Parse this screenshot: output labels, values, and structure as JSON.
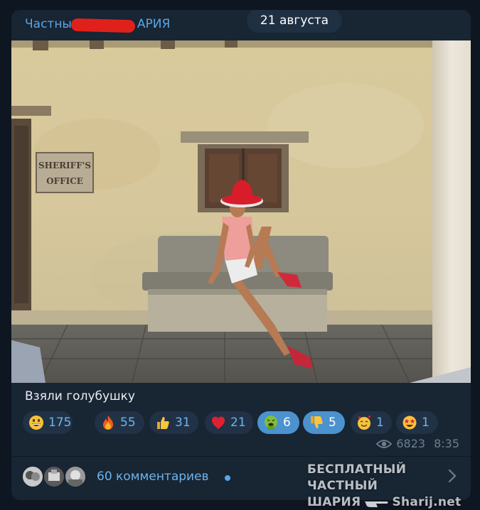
{
  "post": {
    "channel_name_start": "Частны",
    "channel_name_end": "АРИЯ",
    "date": "21 августа",
    "caption": "Взяли голубушку",
    "photo_sign": [
      "SHERIFF'S",
      "OFFICE"
    ],
    "views": "6823",
    "time": "8:35"
  },
  "reactions": [
    {
      "emoji": "grinning-face-icon",
      "count": "175",
      "selected": false
    },
    {
      "emoji": "fire-icon",
      "count": "55",
      "selected": false
    },
    {
      "emoji": "thumbs-up-icon",
      "count": "31",
      "selected": false
    },
    {
      "emoji": "red-heart-icon",
      "count": "21",
      "selected": false
    },
    {
      "emoji": "vomiting-face-icon",
      "count": "6",
      "selected": true
    },
    {
      "emoji": "thumbs-down-icon",
      "count": "5",
      "selected": true
    },
    {
      "emoji": "smiling-face-with-hearts-icon",
      "count": "1",
      "selected": false
    },
    {
      "emoji": "star-struck-icon",
      "count": "1",
      "selected": false
    }
  ],
  "comments": {
    "label": "60 комментариев"
  },
  "watermark": {
    "line1": "БЕСПЛАТНЫЙ ЧАСТНЫЙ",
    "line2_left": "ШАРИЯ",
    "line2_right": "Sharij.net"
  },
  "colors": {
    "background": "#0e1621",
    "bubble": "#182533",
    "accent": "#5aa6e8",
    "reaction_bg": "#213246",
    "reaction_selected": "#4b92cf"
  }
}
